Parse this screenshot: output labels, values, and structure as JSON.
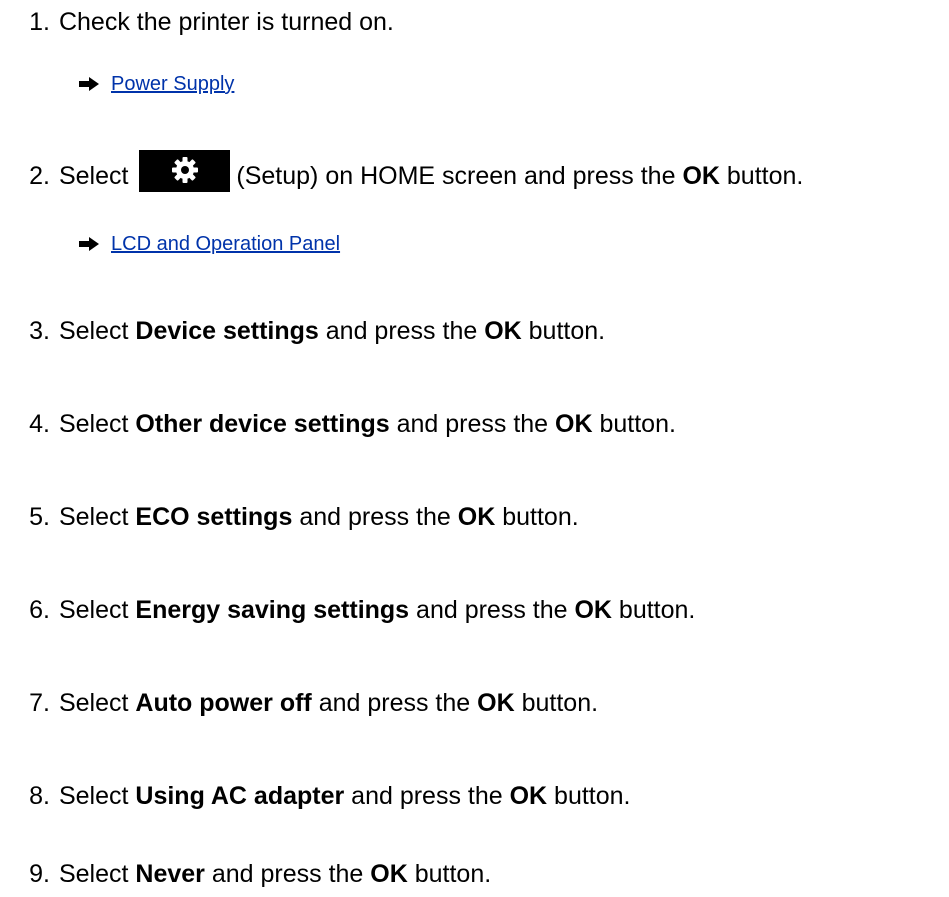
{
  "steps": [
    {
      "number": "1.",
      "parts": {
        "a": "Check the printer is turned on."
      }
    },
    {
      "number": "2.",
      "parts": {
        "a": "Select ",
        "icon_label": "(Setup) on HOME screen and press the ",
        "b": "OK",
        "c": " button."
      }
    },
    {
      "number": "3.",
      "parts": {
        "a": "Select ",
        "b1": "Device settings",
        "a2": " and press the ",
        "b2": "OK",
        "c": " button."
      }
    },
    {
      "number": "4.",
      "parts": {
        "a": "Select ",
        "b1": "Other device settings",
        "a2": " and press the ",
        "b2": "OK",
        "c": " button."
      }
    },
    {
      "number": "5.",
      "parts": {
        "a": "Select ",
        "b1": "ECO settings",
        "a2": " and press the ",
        "b2": "OK",
        "c": " button."
      }
    },
    {
      "number": "6.",
      "parts": {
        "a": "Select ",
        "b1": "Energy saving settings",
        "a2": " and press the ",
        "b2": "OK",
        "c": " button."
      }
    },
    {
      "number": "7.",
      "parts": {
        "a": "Select ",
        "b1": "Auto power off",
        "a2": " and press the ",
        "b2": "OK",
        "c": " button."
      }
    },
    {
      "number": "8.",
      "parts": {
        "a": "Select ",
        "b1": "Using AC adapter",
        "a2": " and press the ",
        "b2": "OK",
        "c": " button."
      }
    },
    {
      "number": "9.",
      "parts": {
        "a": "Select ",
        "b1": "Never",
        "a2": " and press the ",
        "b2": "OK",
        "c": " button."
      }
    }
  ],
  "links": {
    "power_supply": "Power Supply",
    "lcd_panel": "LCD and Operation Panel"
  },
  "colors": {
    "link": "#0033aa",
    "text": "#000000",
    "icon_bg": "#000000"
  },
  "icons": {
    "arrow": "right-arrow-icon",
    "setup": "gear-icon"
  }
}
